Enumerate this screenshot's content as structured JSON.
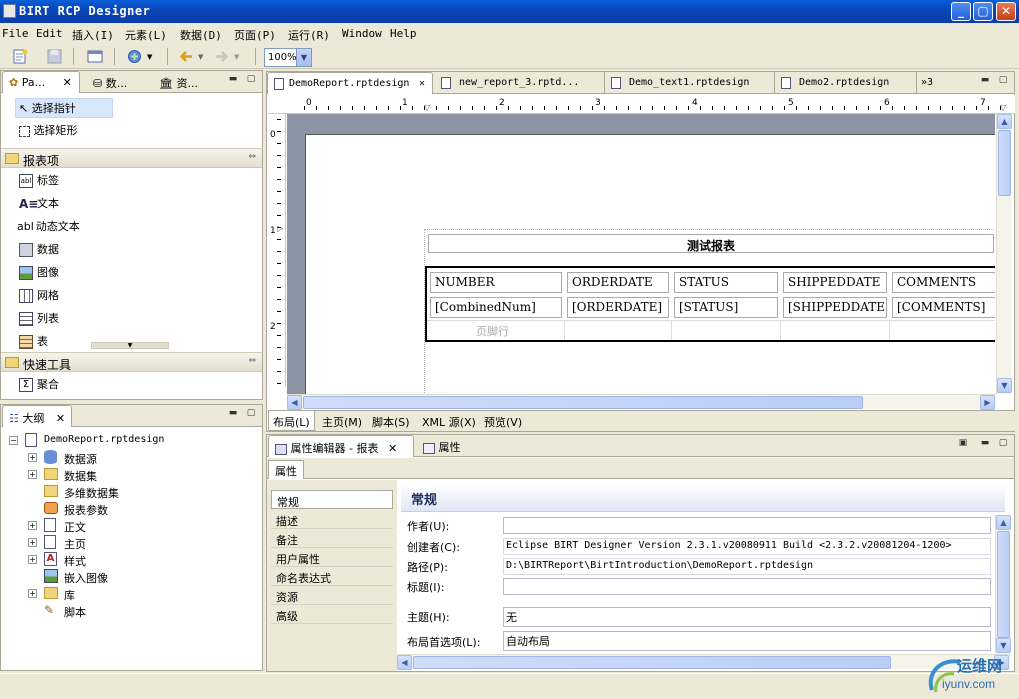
{
  "window": {
    "title": "BIRT RCP Designer"
  },
  "menu": {
    "items": [
      "File",
      "Edit",
      "插入(I)",
      "元素(L)",
      "数据(D)",
      "页面(P)",
      "运行(R)",
      "Window",
      "Help"
    ]
  },
  "toolbar": {
    "zoom": "100%"
  },
  "palette_panel": {
    "tabs": [
      "Pa...",
      "数...",
      "资..."
    ],
    "tools": [
      "选择指针",
      "选择矩形"
    ],
    "group_report_items": "报表项",
    "report_items": [
      "标签",
      "文本",
      "动态文本",
      "数据",
      "图像",
      "网格",
      "列表",
      "表"
    ],
    "group_quick_tools": "快速工具",
    "quick_tools": [
      "聚合"
    ]
  },
  "editor": {
    "tabs": [
      "DemoReport.rptdesign",
      "new_report_3.rptd...",
      "Demo_text1.rptdesign",
      "Demo2.rptdesign",
      "»3"
    ],
    "ruler_numbers": [
      "0",
      "1",
      "2",
      "3",
      "4",
      "5",
      "6",
      "7"
    ],
    "v_ruler": [
      "0",
      "1",
      "2"
    ],
    "report_title": "测试报表",
    "table": {
      "headers": [
        "NUMBER",
        "ORDERDATE",
        "STATUS",
        "SHIPPEDDATE",
        "COMMENTS"
      ],
      "detail": [
        "[CombinedNum]",
        "[ORDERDATE]",
        "[STATUS]",
        "[SHIPPEDDATE]",
        "[COMMENTS]"
      ],
      "footer_label": "页脚行"
    },
    "bottom_tabs": [
      "布局(L)",
      "主页(M)",
      "脚本(S)",
      "XML 源(X)",
      "预览(V)"
    ]
  },
  "outline": {
    "tab": "大纲",
    "root": "DemoReport.rptdesign",
    "nodes": [
      "数据源",
      "数据集",
      "多维数据集",
      "报表参数",
      "正文",
      "主页",
      "样式",
      "嵌入图像",
      "库",
      "脚本"
    ]
  },
  "properties": {
    "tabs": [
      "属性编辑器 - 报表",
      "属性"
    ],
    "subtab": "属性",
    "categories": [
      "常规",
      "描述",
      "备注",
      "用户属性",
      "命名表达式",
      "资源",
      "高级"
    ],
    "section_title": "常规",
    "fields": [
      {
        "label": "作者(U):",
        "value": ""
      },
      {
        "label": "创建者(C):",
        "value": "Eclipse BIRT Designer Version 2.3.1.v20080911 Build <2.3.2.v20081204-1200>"
      },
      {
        "label": "路径(P):",
        "value": "D:\\BIRTReport\\BirtIntroduction\\DemoReport.rptdesign"
      },
      {
        "label": "标题(I):",
        "value": ""
      },
      {
        "label": "主题(H):",
        "value": "无"
      },
      {
        "label": "布局首选项(L):",
        "value": "自动布局"
      }
    ]
  },
  "watermark": {
    "brand": "运维网",
    "url": "iyunv.com"
  }
}
